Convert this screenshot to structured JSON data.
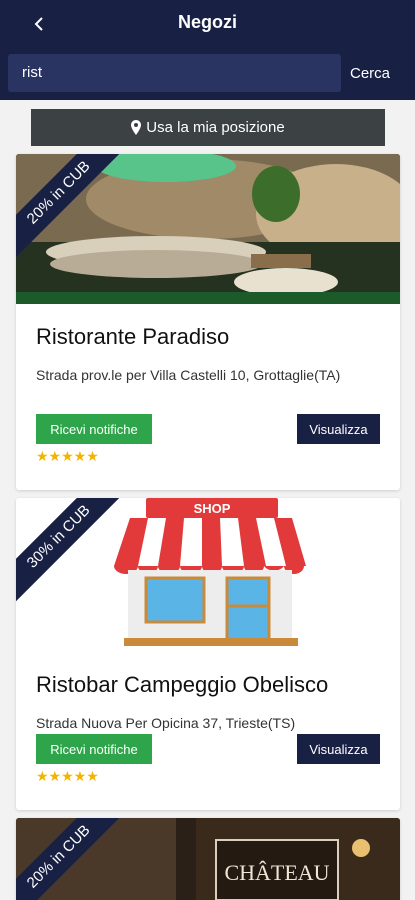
{
  "header": {
    "title": "Negozi",
    "search_value": "rist",
    "search_button": "Cerca"
  },
  "location_button": "Usa la mia posizione",
  "colors": {
    "navy": "#182044",
    "search_bg": "#2a3463",
    "location_bg": "#3c4144",
    "green": "#2ea54a",
    "star": "#f2b400"
  },
  "stores": [
    {
      "discount": "20% in CUB",
      "name": "Ristorante Paradiso",
      "address": "Strada prov.le per Villa Castelli 10, Grottaglie(TA)",
      "notify_label": "Ricevi notifiche",
      "view_label": "Visualizza",
      "rating": 5,
      "stars": "★★★★★"
    },
    {
      "discount": "30% in CUB",
      "name": "Ristobar Campeggio Obelisco",
      "address": "Strada Nuova Per Opicina 37, Trieste(TS)",
      "notify_label": "Ricevi notifiche",
      "view_label": "Visualizza",
      "rating": 5,
      "stars": "★★★★★",
      "shop_sign": "SHOP"
    },
    {
      "discount": "20% in CUB",
      "sign_text": "CHÂTEAU"
    }
  ]
}
